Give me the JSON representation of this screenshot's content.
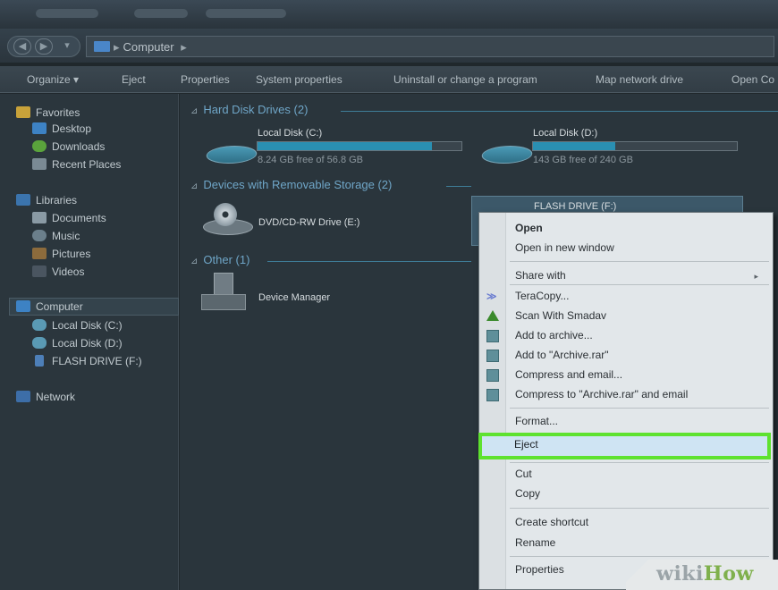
{
  "address": {
    "crumb": "Computer",
    "separator": "▸"
  },
  "toolbar": {
    "organize": "Organize ▾",
    "eject": "Eject",
    "properties": "Properties",
    "system_properties": "System properties",
    "uninstall": "Uninstall or change a program",
    "map_drive": "Map network drive",
    "open_control": "Open Co"
  },
  "sidebar": {
    "favorites": "Favorites",
    "desktop": "Desktop",
    "downloads": "Downloads",
    "recent": "Recent Places",
    "libraries": "Libraries",
    "documents": "Documents",
    "music": "Music",
    "pictures": "Pictures",
    "videos": "Videos",
    "computer": "Computer",
    "local_c": "Local Disk (C:)",
    "local_d": "Local Disk (D:)",
    "flash": "FLASH DRIVE (F:)",
    "network": "Network"
  },
  "main": {
    "hard_disks_heading": "Hard Disk Drives (2)",
    "removable_heading": "Devices with Removable Storage (2)",
    "other_heading": "Other (1)",
    "drive_c": {
      "name": "Local Disk (C:)",
      "free": "8.24 GB free of 56.8 GB",
      "used_fraction": 0.855
    },
    "drive_d": {
      "name": "Local Disk (D:)",
      "free": "143 GB free of 240 GB",
      "used_fraction": 0.404
    },
    "dvd": "DVD/CD-RW Drive (E:)",
    "flash": "FLASH DRIVE (F:)",
    "device_manager": "Device Manager"
  },
  "context_menu": {
    "open": "Open",
    "open_new_window": "Open in new window",
    "share_with": "Share with",
    "teracopy": "TeraCopy...",
    "smadav": "Scan With Smadav",
    "add_archive": "Add to archive...",
    "add_archive_rar": "Add to \"Archive.rar\"",
    "compress_email": "Compress and email...",
    "compress_rar_email": "Compress to \"Archive.rar\" and email",
    "format": "Format...",
    "eject": "Eject",
    "cut": "Cut",
    "copy": "Copy",
    "create_shortcut": "Create shortcut",
    "rename": "Rename",
    "properties": "Properties",
    "submenu_arrow": "▸"
  },
  "watermark": {
    "wiki": "wiki",
    "how": "How"
  },
  "colors": {
    "highlight": "#5ee22f",
    "accent": "#2a8fb2"
  }
}
